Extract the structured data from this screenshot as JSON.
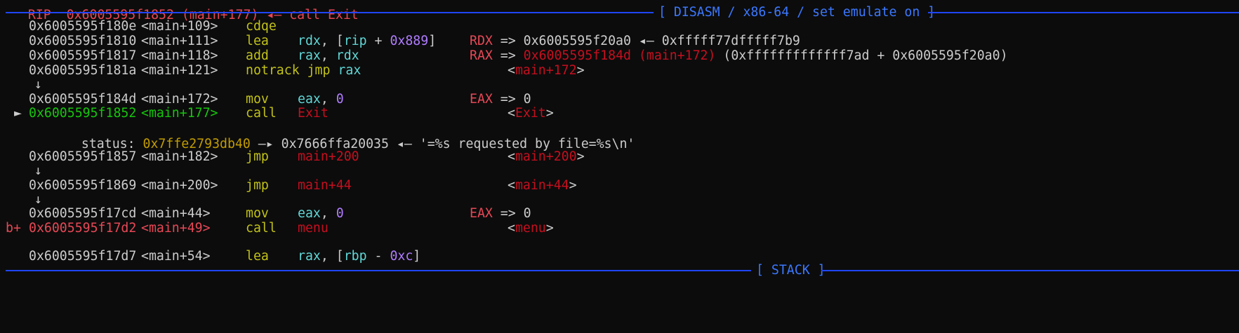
{
  "top_partial": {
    "text": "RIP  0x6005595f1852 (main+177) ◂— call Exit"
  },
  "disasm_header": "[ DISASM / x86-64 / set emulate on ]",
  "stack_header": "[ STACK ]",
  "rows": [
    {
      "prefix": "",
      "addr": "0x6005595f180e",
      "sym": "<main+109>",
      "mn": "cdqe",
      "ops": "",
      "comment": ""
    },
    {
      "prefix": "",
      "addr": "0x6005595f1810",
      "sym": "<main+111>",
      "mn": "lea",
      "ops": "rdx, [rip + 0x889]",
      "comment": "RDX => 0x6005595f20a0 ◂— 0xfffff77dfffff7b9"
    },
    {
      "prefix": "",
      "addr": "0x6005595f1817",
      "sym": "<main+118>",
      "mn": "add",
      "ops": "rax, rdx",
      "comment": "RAX => 0x6005595f184d (main+172) (0xfffffffffffff7ad + 0x6005595f20a0)"
    },
    {
      "prefix": "",
      "addr": "0x6005595f181a",
      "sym": "<main+121>",
      "mn": "notrack",
      "ops": "jmp rax",
      "comment": "<main+172>"
    },
    {
      "prefix": "",
      "addr": "0x6005595f184d",
      "sym": "<main+172>",
      "mn": "mov",
      "ops": "eax, 0",
      "comment": "EAX => 0"
    },
    {
      "prefix": "►",
      "addr": "0x6005595f1852",
      "sym": "<main+177>",
      "mn": "call",
      "ops": "Exit",
      "comment": "<Exit>"
    },
    {
      "prefix": "",
      "addr": "0x6005595f1857",
      "sym": "<main+182>",
      "mn": "jmp",
      "ops": "main+200",
      "comment": "<main+200>"
    },
    {
      "prefix": "",
      "addr": "0x6005595f1869",
      "sym": "<main+200>",
      "mn": "jmp",
      "ops": "main+44",
      "comment": "<main+44>"
    },
    {
      "prefix": "",
      "addr": "0x6005595f17cd",
      "sym": "<main+44>",
      "mn": "mov",
      "ops": "eax, 0",
      "comment": "EAX => 0"
    },
    {
      "prefix": "b+",
      "addr": "0x6005595f17d2",
      "sym": "<main+49>",
      "mn": "call",
      "ops": "menu",
      "comment": "<menu>"
    },
    {
      "prefix": "",
      "addr": "0x6005595f17d7",
      "sym": "<main+54>",
      "mn": "lea",
      "ops": "rax, [rbp - 0xc]",
      "comment": ""
    }
  ],
  "status_line": {
    "label": "status:",
    "value": "0x7ffe2793db40",
    "arrow": "—▸",
    "target": "0x7666ffa20035",
    "arrow2": "◂—",
    "string": "'=%s requested by file=%s\\n'"
  },
  "jump_arrow": "↓",
  "colors": {
    "background": "#0c0c0c",
    "address": "#cccccc",
    "mnemonic": "#c1c11a",
    "register": "#61d6d6",
    "number": "#b07cff",
    "symbol": "#c50f1f",
    "current": "#16c60c",
    "pointer": "#c19c00",
    "separator": "#1f45ff"
  }
}
